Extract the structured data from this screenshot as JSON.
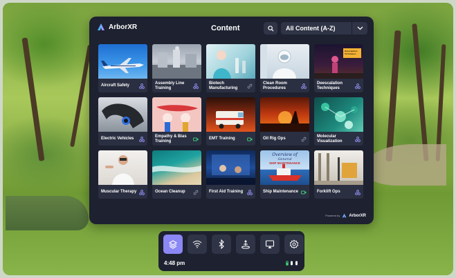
{
  "brand": {
    "name": "ArborXR",
    "logo_icon": "arborxr-logo-icon"
  },
  "header": {
    "title": "Content",
    "search_icon": "search-icon",
    "sort": {
      "selected": "All Content (A-Z)",
      "chevron_icon": "chevron-down-icon"
    }
  },
  "content": {
    "items": [
      {
        "title": "Aircraft Safety",
        "icon": "vr-app-icon"
      },
      {
        "title": "Assembly Line Training",
        "icon": "vr-app-icon"
      },
      {
        "title": "Biotech Manufacturing",
        "icon": "link-icon"
      },
      {
        "title": "Clean Room Procedures",
        "icon": "vr-app-icon"
      },
      {
        "title": "Deescalation Techniques",
        "icon": "vr-app-icon"
      },
      {
        "title": "Electric Vehicles",
        "icon": "vr-app-icon"
      },
      {
        "title": "Empathy & Bias Training",
        "icon": "video-icon"
      },
      {
        "title": "EMT Training",
        "icon": "video-icon"
      },
      {
        "title": "Oil Rig Ops",
        "icon": "link-icon"
      },
      {
        "title": "Molecular Visualization",
        "icon": "vr-app-icon"
      },
      {
        "title": "Muscular Therapy",
        "icon": "vr-app-icon"
      },
      {
        "title": "Ocean Cleanup",
        "icon": "link-icon"
      },
      {
        "title": "First Aid Training",
        "icon": "vr-app-icon"
      },
      {
        "title": "Ship Maintenance",
        "icon": "video-icon"
      },
      {
        "title": "Forklift Ops",
        "icon": "vr-app-icon"
      }
    ],
    "thumb_texts": {
      "deescalation": "Deescalation Techniques",
      "ship_line1": "Overview of",
      "ship_line2": "General",
      "ship_line3": "SHIP MAINTENANCE"
    }
  },
  "footer": {
    "powered_by": "Powered by",
    "brand": "ArborXR"
  },
  "dock": {
    "buttons": [
      {
        "name": "library-button",
        "icon": "layers-icon",
        "active": true
      },
      {
        "name": "wifi-button",
        "icon": "wifi-icon",
        "active": false
      },
      {
        "name": "bluetooth-button",
        "icon": "bluetooth-icon",
        "active": false
      },
      {
        "name": "boundary-button",
        "icon": "guardian-icon",
        "active": false
      },
      {
        "name": "cast-button",
        "icon": "cast-icon",
        "active": false
      },
      {
        "name": "settings-button",
        "icon": "gear-icon",
        "active": false
      }
    ],
    "time": "4:48 pm",
    "status_icons": [
      "battery-icon",
      "controller-left-icon",
      "controller-right-icon"
    ]
  },
  "colors": {
    "panel": "#1d2130",
    "button": "#2f3446",
    "accent": "#8b87f4",
    "icon_accent": "#9b97ff",
    "video_green": "#3fd07a"
  }
}
